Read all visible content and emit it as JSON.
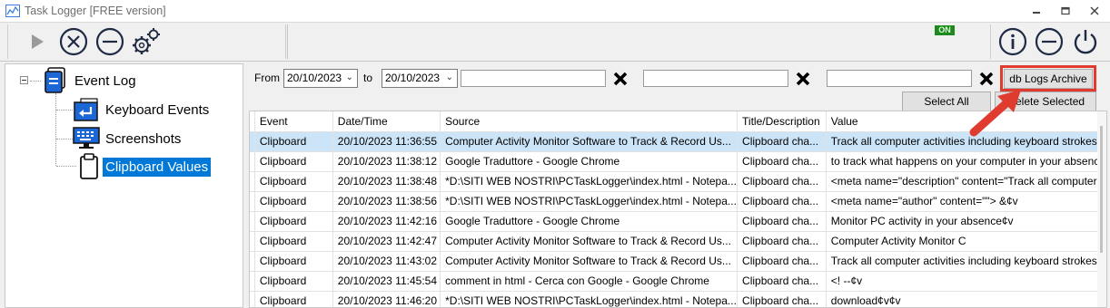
{
  "window": {
    "title": "Task Logger [FREE version]",
    "status_badge": "ON"
  },
  "toolbar": {
    "left_icons": [
      "play-icon",
      "stop-circle-x-icon",
      "minus-circle-icon",
      "settings-gears-icon"
    ],
    "right_icons": [
      "info-icon",
      "minimize-circle-icon",
      "power-icon"
    ]
  },
  "tree": {
    "root": "Event Log",
    "children": [
      "Keyboard Events",
      "Screenshots",
      "Clipboard Values"
    ],
    "selected": "Clipboard Values"
  },
  "filters": {
    "from_label": "From",
    "from_date": "20/10/2023",
    "to_label": "to",
    "to_date": "20/10/2023",
    "filter1": "",
    "filter2": "",
    "filter3": "",
    "db_archive_label": "db Logs Archive",
    "select_all_label": "Select All",
    "delete_selected_label": "elete Selected"
  },
  "table": {
    "columns": [
      "Event",
      "Date/Time",
      "Source",
      "Title/Description",
      "Value"
    ],
    "rows": [
      [
        "Clipboard",
        "20/10/2023 11:36:55",
        "Computer Activity Monitor Software to Track & Record Us...",
        "Clipboard cha...",
        "Track all computer activities including keyboard strokes"
      ],
      [
        "Clipboard",
        "20/10/2023 11:38:12",
        "Google Traduttore - Google Chrome",
        "Clipboard cha...",
        "to track what happens on your computer in your absence"
      ],
      [
        "Clipboard",
        "20/10/2023 11:38:48",
        "*D:\\SITI WEB NOSTRI\\PCTaskLogger\\index.html - Notepa...",
        "Clipboard cha...",
        "<meta name=\"description\" content=\"Track all computer"
      ],
      [
        "Clipboard",
        "20/10/2023 11:38:56",
        "*D:\\SITI WEB NOSTRI\\PCTaskLogger\\index.html - Notepa...",
        "Clipboard cha...",
        "  <meta name=\"author\" content=\"\"> &¢v"
      ],
      [
        "Clipboard",
        "20/10/2023 11:42:16",
        "Google Traduttore - Google Chrome",
        "Clipboard cha...",
        "Monitor PC activity in your absence¢v"
      ],
      [
        "Clipboard",
        "20/10/2023 11:42:47",
        "Computer Activity Monitor Software to Track & Record Us...",
        "Clipboard cha...",
        "Computer Activity Monitor C"
      ],
      [
        "Clipboard",
        "20/10/2023 11:43:02",
        "Computer Activity Monitor Software to Track & Record Us...",
        "Clipboard cha...",
        "Track all computer activities including keyboard strokes"
      ],
      [
        "Clipboard",
        "20/10/2023 11:45:54",
        "comment in html - Cerca con Google - Google Chrome",
        "Clipboard cha...",
        "<! --¢v"
      ],
      [
        "Clipboard",
        "20/10/2023 11:46:20",
        "*D:\\SITI WEB NOSTRI\\PCTaskLogger\\index.html - Notepa...",
        "Clipboard cha...",
        "download¢v¢v"
      ]
    ],
    "selected_row": 0
  },
  "colors": {
    "selection": "#0078d7",
    "row_selection": "#cce4f7",
    "highlight": "#e03b2f",
    "on_badge": "#1e8a1e"
  }
}
